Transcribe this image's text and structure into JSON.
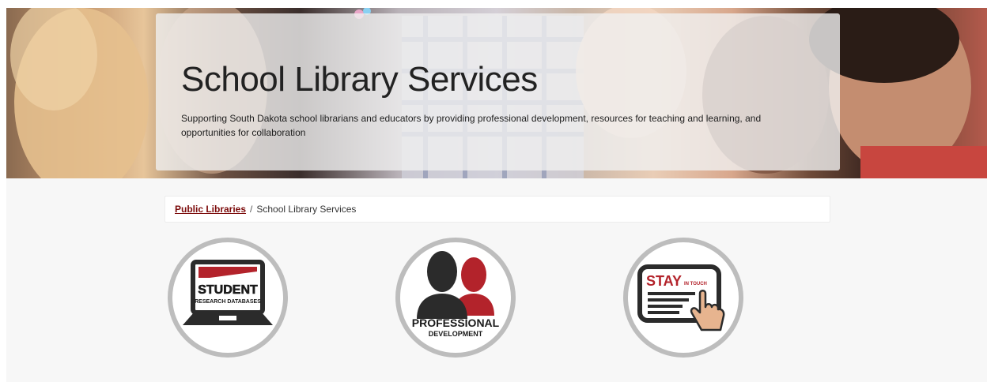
{
  "hero": {
    "title": "School Library Services",
    "subtitle": "Supporting South Dakota school librarians and educators by providing professional development, resources for teaching and learning, and opportunities for collaboration"
  },
  "breadcrumb": {
    "parent": "Public Libraries",
    "separator": "/",
    "current": "School Library Services"
  },
  "tiles": [
    {
      "name": "student-research-databases",
      "line1": "STUDENT",
      "line2": "RESEARCH DATABASES"
    },
    {
      "name": "professional-development",
      "line1": "PROFESSIONAL",
      "line2": "DEVELOPMENT"
    },
    {
      "name": "stay-in-touch",
      "line1": "STAY",
      "line2": "IN TOUCH"
    }
  ],
  "colors": {
    "accent_red": "#b3232b",
    "link_red": "#7b0a0a",
    "icon_dark": "#2b2b2b",
    "ring_gray": "#bdbdbd"
  }
}
